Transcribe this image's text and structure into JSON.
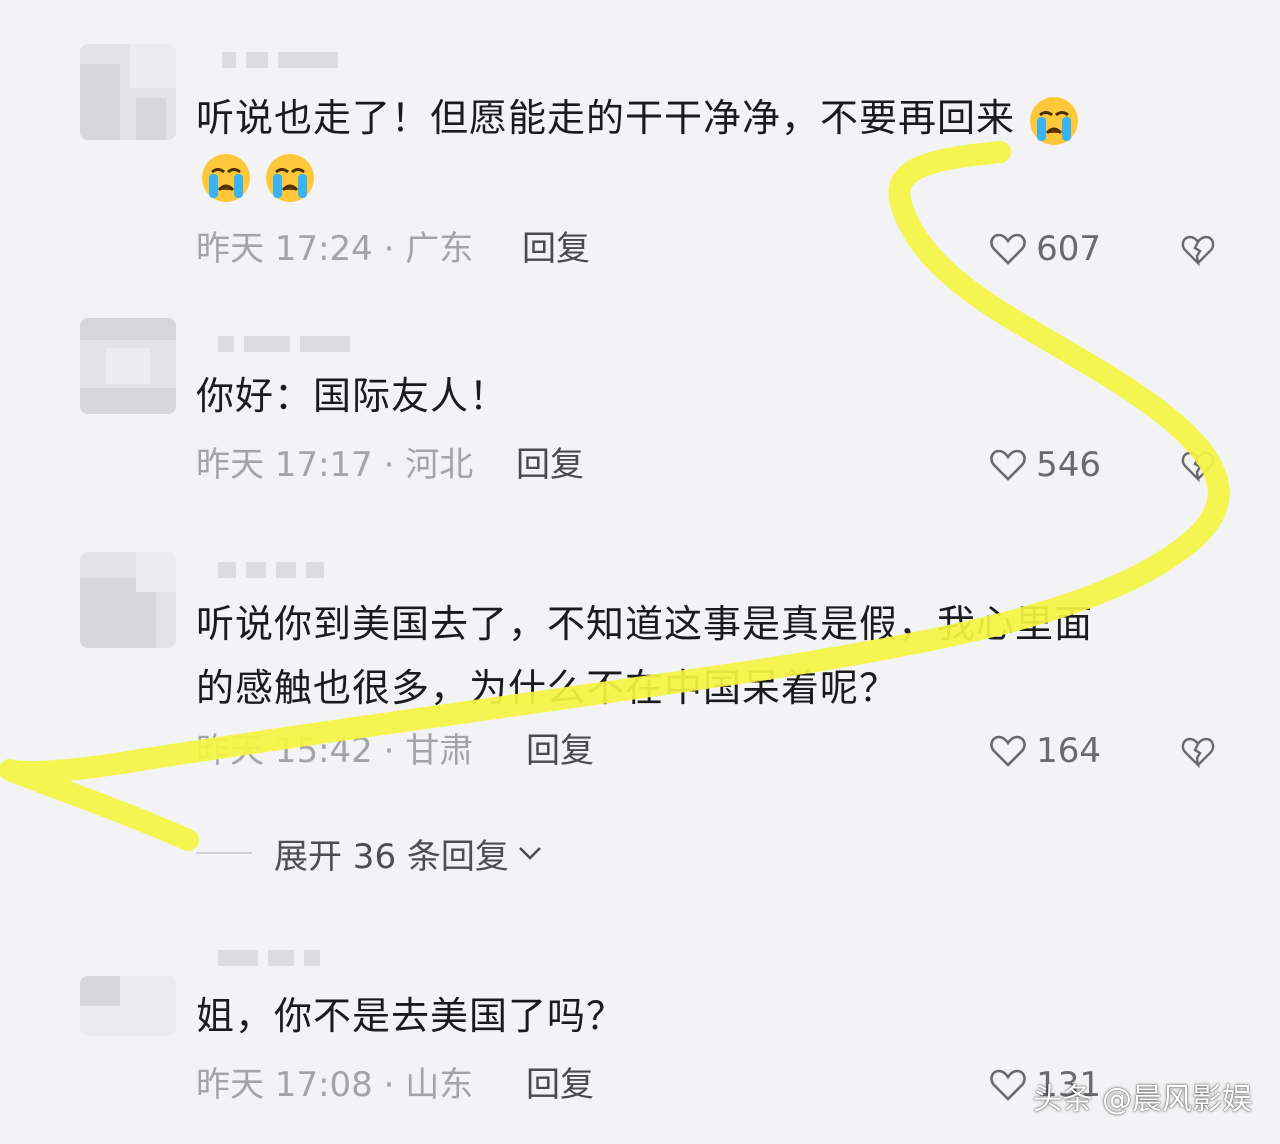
{
  "comments": [
    {
      "text_lines": [
        "听说也走了！但愿能走的干干净净，不要再回来"
      ],
      "emoji_count_inline": 1,
      "emoji_row": 2,
      "time": "昨天 17:24 · 广东",
      "reply": "回复",
      "likes": "607"
    },
    {
      "text_lines": [
        "你好：国际友人！"
      ],
      "time": "昨天 17:17 · 河北",
      "reply": "回复",
      "likes": "546"
    },
    {
      "text_lines": [
        "听说你到美国去了，不知道这事是真是假，我心里面",
        "的感触也很多，为什么不在中国呆着呢？"
      ],
      "time": "昨天 15:42 · 甘肃",
      "reply": "回复",
      "likes": "164"
    },
    {
      "text_lines": [
        "姐，你不是去美国了吗？"
      ],
      "time": "昨天 17:08 · 山东",
      "reply": "回复",
      "likes": "131"
    }
  ],
  "expand_replies": "展开 36 条回复",
  "watermark": "头条 @晨风影娱",
  "colors": {
    "background": "#f3f3f5",
    "highlight": "#f5f542",
    "meta_gray": "#a4a4a8"
  },
  "icons": [
    "heart-outline-icon",
    "broken-heart-icon",
    "crying-emoji-icon",
    "chevron-down-icon"
  ]
}
